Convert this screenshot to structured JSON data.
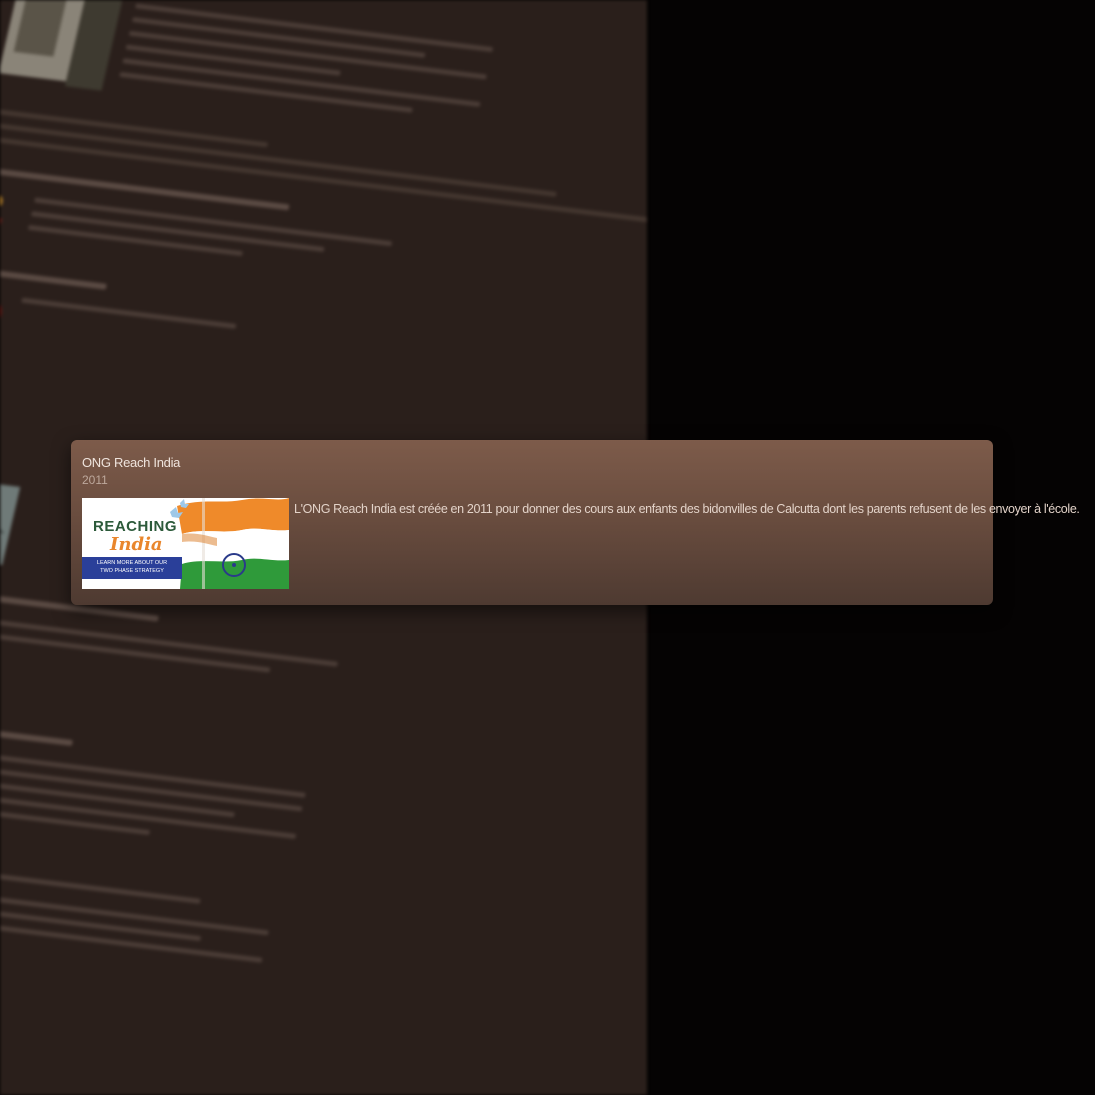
{
  "card": {
    "title": "ONG Reach India",
    "year": "2011",
    "description": "L'ONG Reach India est créée en 2011 pour donner des cours aux enfants des bidonvilles de Calcutta dont les parents refusent de les envoyer à l'école.",
    "image": {
      "logo_text": "REACHING",
      "logo_subtext": "India",
      "banner_line1": "LEARN MORE ABOUT OUR",
      "banner_line2": "TWO PHASE STRATEGY"
    }
  },
  "colors": {
    "page_background": "#050303",
    "document_background": "#2a1f1b",
    "card_top": "#7d5b4a",
    "card_bottom": "#4e3a31",
    "card_title": "#efe4dd",
    "card_text": "#e3d3c9"
  }
}
